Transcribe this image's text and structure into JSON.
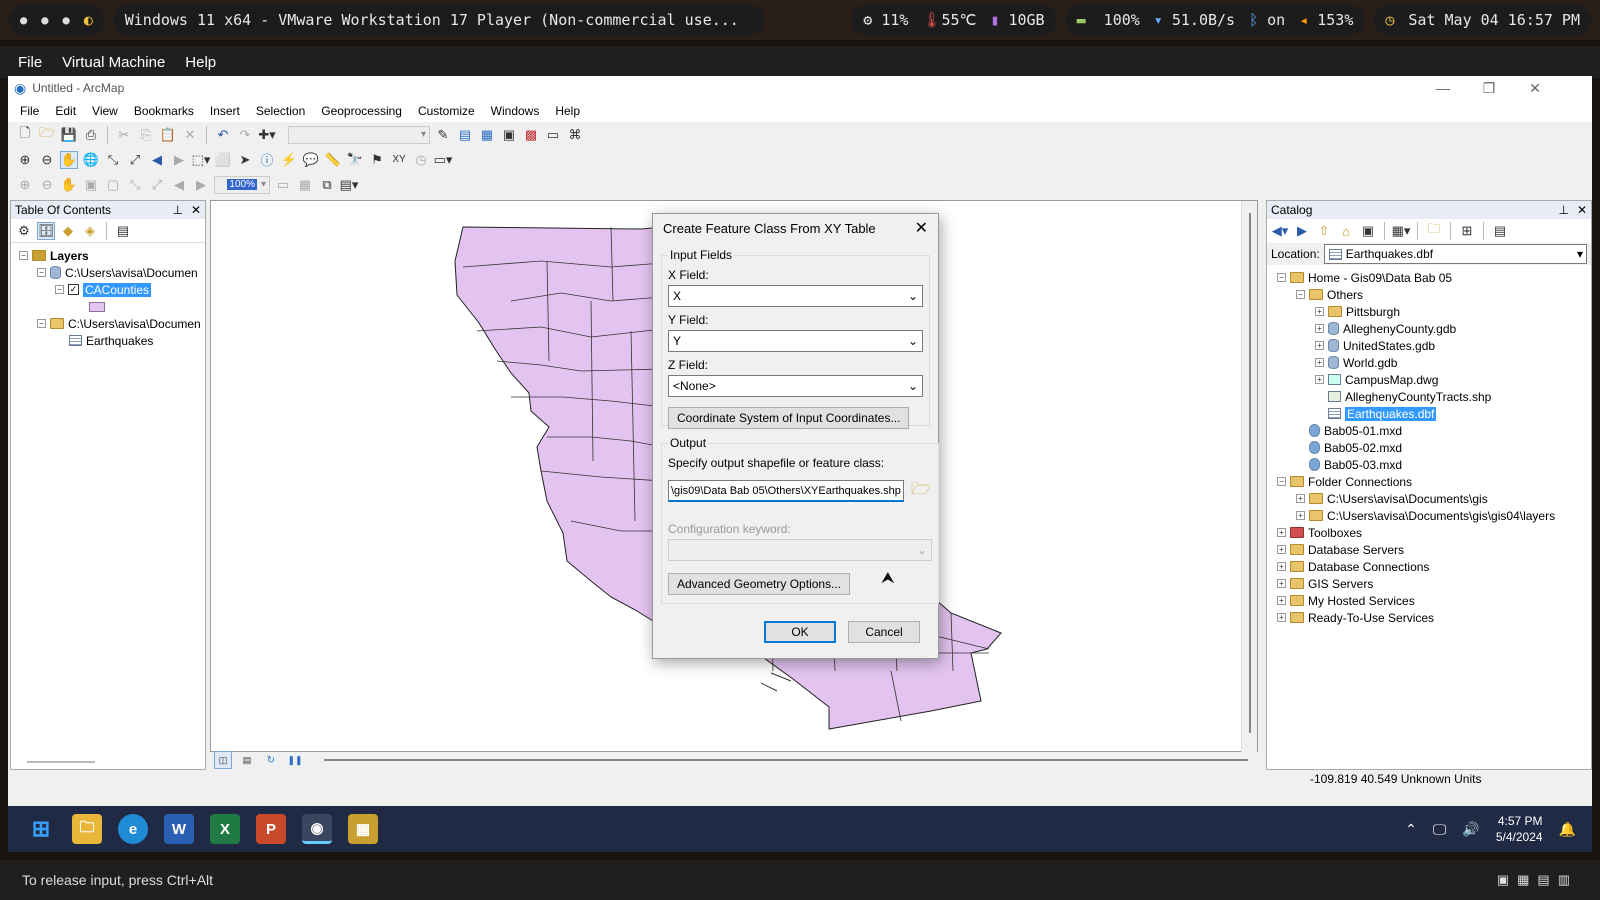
{
  "host_bar": {
    "vm_title": "Windows 11 x64 - VMware Workstation 17 Player (Non-commercial use...",
    "cpu": "11%",
    "temp": "55℃",
    "mem": "10GB",
    "battery": "100%",
    "net": "51.0B/s",
    "bluetooth": "on",
    "volume": "153%",
    "clock": "Sat May 04 16:57 PM"
  },
  "vmware_menu": [
    "File",
    "Virtual Machine",
    "Help"
  ],
  "arcmap": {
    "title": "Untitled - ArcMap",
    "menu": [
      "File",
      "Edit",
      "View",
      "Bookmarks",
      "Insert",
      "Selection",
      "Geoprocessing",
      "Customize",
      "Windows",
      "Help"
    ],
    "toc": {
      "title": "Table Of Contents",
      "layers_label": "Layers",
      "group1": "C:\\Users\\avisa\\Documen",
      "layer1": "CACounties",
      "group2": "C:\\Users\\avisa\\Documen",
      "layer2": "Earthquakes"
    },
    "catalog": {
      "title": "Catalog",
      "location_label": "Location:",
      "location_value": "Earthquakes.dbf",
      "items": [
        {
          "label": "Home - Gis09\\Data Bab 05",
          "level": 0,
          "pm": "−",
          "icon": "folder"
        },
        {
          "label": "Others",
          "level": 1,
          "pm": "−",
          "icon": "folder"
        },
        {
          "label": "Pittsburgh",
          "level": 2,
          "pm": "+",
          "icon": "folder"
        },
        {
          "label": "AlleghenyCounty.gdb",
          "level": 2,
          "pm": "+",
          "icon": "db"
        },
        {
          "label": "UnitedStates.gdb",
          "level": 2,
          "pm": "+",
          "icon": "db"
        },
        {
          "label": "World.gdb",
          "level": 2,
          "pm": "+",
          "icon": "db"
        },
        {
          "label": "CampusMap.dwg",
          "level": 2,
          "pm": "+",
          "icon": "dwg"
        },
        {
          "label": "AlleghenyCountyTracts.shp",
          "level": 2,
          "pm": "",
          "icon": "shp"
        },
        {
          "label": "Earthquakes.dbf",
          "level": 2,
          "pm": "",
          "icon": "table",
          "selected": true
        },
        {
          "label": "Bab05-01.mxd",
          "level": 1,
          "pm": "",
          "icon": "mxd"
        },
        {
          "label": "Bab05-02.mxd",
          "level": 1,
          "pm": "",
          "icon": "mxd"
        },
        {
          "label": "Bab05-03.mxd",
          "level": 1,
          "pm": "",
          "icon": "mxd"
        },
        {
          "label": "Folder Connections",
          "level": 0,
          "pm": "−",
          "icon": "folder"
        },
        {
          "label": "C:\\Users\\avisa\\Documents\\gis",
          "level": 1,
          "pm": "+",
          "icon": "folder"
        },
        {
          "label": "C:\\Users\\avisa\\Documents\\gis\\gis04\\layers",
          "level": 1,
          "pm": "+",
          "icon": "folder"
        },
        {
          "label": "Toolboxes",
          "level": 0,
          "pm": "+",
          "icon": "toolbox"
        },
        {
          "label": "Database Servers",
          "level": 0,
          "pm": "+",
          "icon": "folder"
        },
        {
          "label": "Database Connections",
          "level": 0,
          "pm": "+",
          "icon": "folder"
        },
        {
          "label": "GIS Servers",
          "level": 0,
          "pm": "+",
          "icon": "folder"
        },
        {
          "label": "My Hosted Services",
          "level": 0,
          "pm": "+",
          "icon": "folder"
        },
        {
          "label": "Ready-To-Use Services",
          "level": 0,
          "pm": "+",
          "icon": "folder"
        }
      ]
    },
    "status_coords": "-109.819  40.549 Unknown Units",
    "zoom_combo": "100%"
  },
  "dialog": {
    "title": "Create Feature Class From XY Table",
    "input_fields_legend": "Input Fields",
    "x_label": "X Field:",
    "x_value": "X",
    "y_label": "Y Field:",
    "y_value": "Y",
    "z_label": "Z Field:",
    "z_value": "<None>",
    "coord_button": "Coordinate System of Input Coordinates...",
    "output_legend": "Output",
    "output_prompt": "Specify output shapefile or feature class:",
    "output_value": "\\gis09\\Data Bab 05\\Others\\XYEarthquakes.shp",
    "config_label": "Configuration keyword:",
    "advanced_button": "Advanced Geometry Options...",
    "ok": "OK",
    "cancel": "Cancel"
  },
  "taskbar": {
    "time": "4:57 PM",
    "date": "5/4/2024"
  },
  "vm_status": "To release input, press Ctrl+Alt"
}
